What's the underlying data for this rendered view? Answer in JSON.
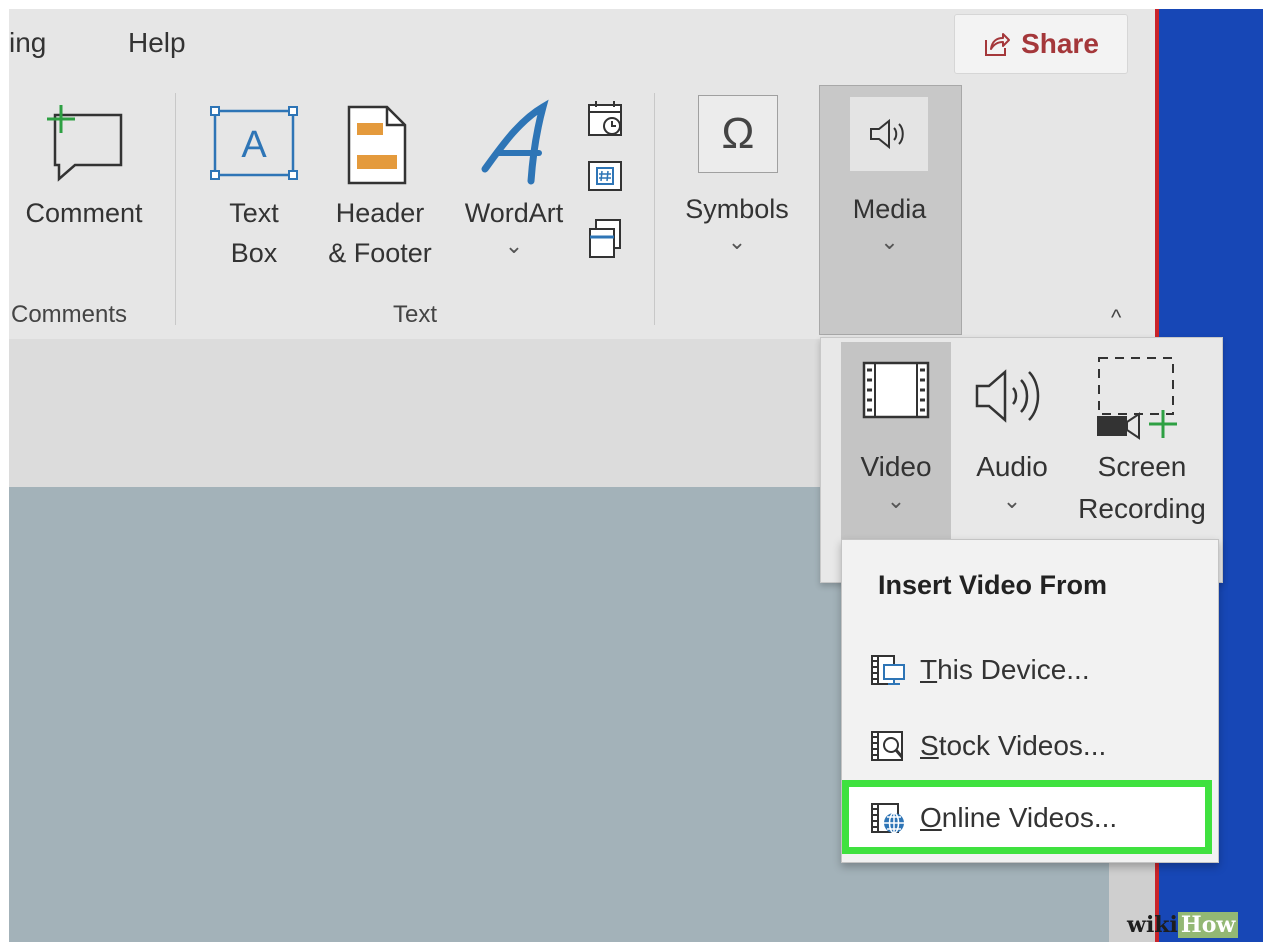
{
  "menu": {
    "tab_partial": "ing",
    "tab_help": "Help"
  },
  "share": {
    "label": "Share"
  },
  "ribbon": {
    "comment": "Comment",
    "text_box_line1": "Text",
    "text_box_line2": "Box",
    "header_footer_line1": "Header",
    "header_footer_line2": "& Footer",
    "wordart": "WordArt",
    "symbols": "Symbols",
    "media": "Media",
    "chevron": "⌄",
    "omega": "Ω",
    "textbox_glyph": "A",
    "collapse": "^"
  },
  "groups": {
    "comments": "Comments",
    "text": "Text"
  },
  "media_panel": {
    "video": "Video",
    "audio": "Audio",
    "screen_recording_line1": "Screen",
    "screen_recording_line2": "Recording"
  },
  "dropdown": {
    "header": "Insert Video From",
    "items": [
      {
        "first": "T",
        "rest": "his Device..."
      },
      {
        "first": "S",
        "rest": "tock Videos..."
      },
      {
        "first": "O",
        "rest": "nline Videos..."
      }
    ]
  },
  "watermark": {
    "wiki": "wiki",
    "how": "How"
  },
  "colors": {
    "share_red": "#a4373a",
    "highlight_green": "#3fe13f",
    "side_blue": "#1747b6",
    "accent_blue": "#2e75b6",
    "comment_green": "#2ea043",
    "header_orange": "#e49a3c"
  }
}
